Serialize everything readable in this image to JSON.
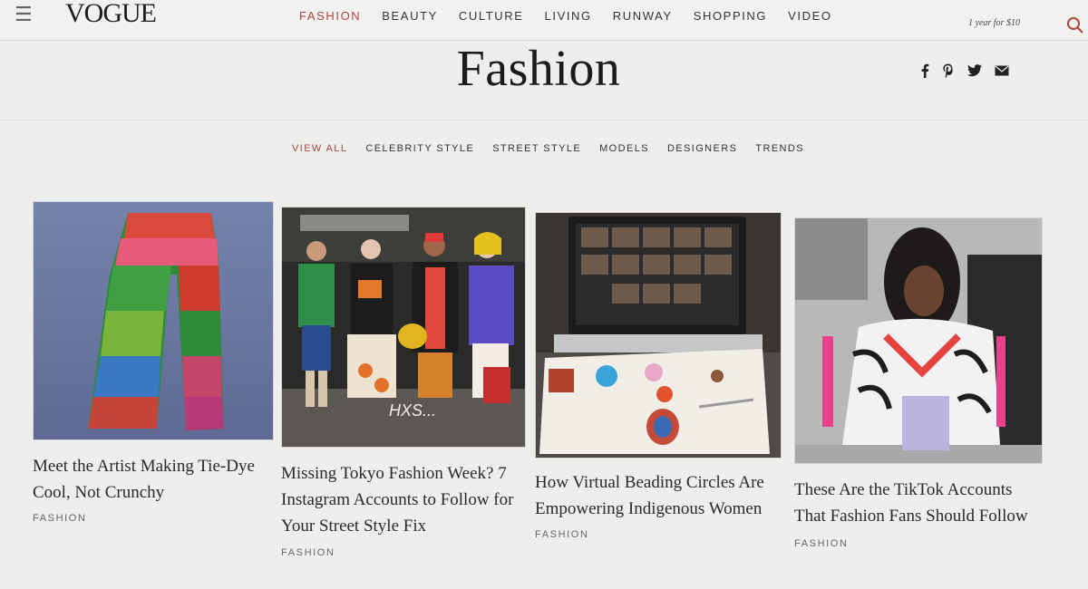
{
  "header": {
    "logo": "VOGUE",
    "menu_icon": "hamburger-icon",
    "nav": [
      {
        "label": "FASHION",
        "active": true
      },
      {
        "label": "BEAUTY",
        "active": false
      },
      {
        "label": "CULTURE",
        "active": false
      },
      {
        "label": "LIVING",
        "active": false
      },
      {
        "label": "RUNWAY",
        "active": false
      },
      {
        "label": "SHOPPING",
        "active": false
      },
      {
        "label": "VIDEO",
        "active": false
      }
    ],
    "subscribe_text": "1 year for $10",
    "search_icon": "search-icon"
  },
  "page": {
    "title": "Fashion",
    "social_icons": [
      "facebook-icon",
      "pinterest-icon",
      "twitter-icon",
      "email-icon"
    ]
  },
  "subnav": [
    {
      "label": "VIEW ALL",
      "active": true
    },
    {
      "label": "CELEBRITY STYLE",
      "active": false
    },
    {
      "label": "STREET STYLE",
      "active": false
    },
    {
      "label": "MODELS",
      "active": false
    },
    {
      "label": "DESIGNERS",
      "active": false
    },
    {
      "label": "TRENDS",
      "active": false
    }
  ],
  "articles": [
    {
      "title": "Meet the Artist Making Tie-Dye Cool, Not Crunchy",
      "tag": "FASHION"
    },
    {
      "title": "Missing Tokyo Fashion Week? 7 Instagram Accounts to Follow for Your Street Style Fix",
      "tag": "FASHION",
      "image_overlay": "HXS..."
    },
    {
      "title": "How Virtual Beading Circles Are Empowering Indigenous Women",
      "tag": "FASHION"
    },
    {
      "title": "These Are the TikTok Accounts That Fashion Fans Should Follow",
      "tag": "FASHION"
    }
  ],
  "colors": {
    "accent": "#b0453a",
    "background": "#eeeeec",
    "text": "#222222"
  }
}
